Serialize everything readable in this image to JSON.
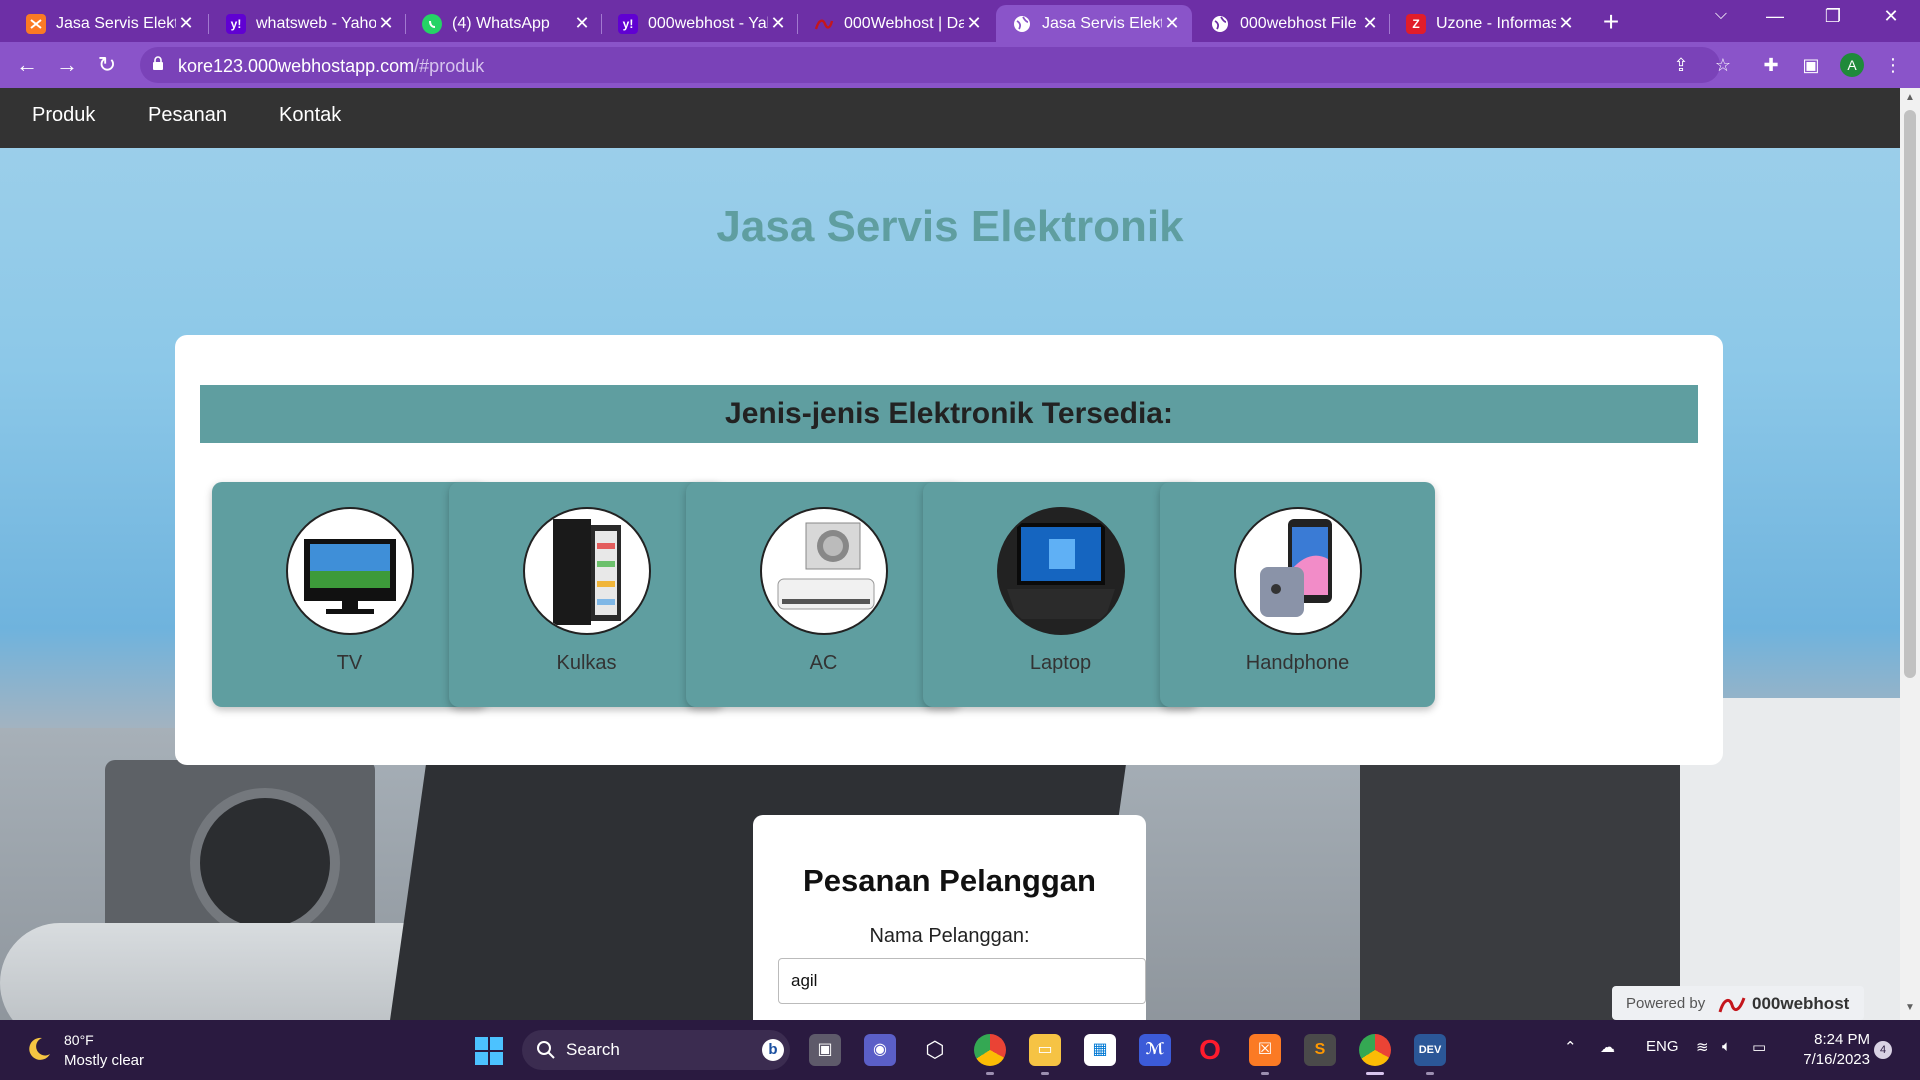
{
  "browser": {
    "tabs": [
      {
        "title": "Jasa Servis Elektronik",
        "favicon": "xampp-icon",
        "fav_color": "#fb7a24",
        "fav_text": "",
        "active": false
      },
      {
        "title": "whatsweb - Yahoo Search",
        "favicon": "yahoo-icon",
        "fav_color": "#6001d2",
        "fav_text": "y!",
        "active": false
      },
      {
        "title": "(4) WhatsApp",
        "favicon": "whatsapp-icon",
        "fav_color": "#25d366",
        "fav_text": "",
        "active": false
      },
      {
        "title": "000webhost - Yahoo Search",
        "favicon": "yahoo-icon",
        "fav_color": "#6001d2",
        "fav_text": "y!",
        "active": false
      },
      {
        "title": "000Webhost | Dashboard",
        "favicon": "000webhost-icon",
        "fav_color": "#c4161c",
        "fav_text": "",
        "active": false
      },
      {
        "title": "Jasa Servis Elektronik",
        "favicon": "globe-icon",
        "fav_color": "#ffffff",
        "fav_text": "",
        "active": true
      },
      {
        "title": "000webhost File Manager",
        "favicon": "globe-icon",
        "fav_color": "#ffffff",
        "fav_text": "",
        "active": false
      },
      {
        "title": "Uzone - Informasi",
        "favicon": "uzone-icon",
        "fav_color": "#e11d2a",
        "fav_text": "Z",
        "active": false
      }
    ],
    "url_host": "kore123.000webhostapp.com",
    "url_path": "/#produk",
    "profile_initial": "A"
  },
  "site": {
    "nav": [
      "Produk",
      "Pesanan",
      "Kontak"
    ],
    "hero_title": "Jasa Servis Elektronik",
    "products_heading": "Jenis-jenis Elektronik Tersedia:",
    "products": [
      {
        "label": "TV",
        "icon": "tv-icon"
      },
      {
        "label": "Kulkas",
        "icon": "fridge-icon"
      },
      {
        "label": "AC",
        "icon": "air-conditioner-icon"
      },
      {
        "label": "Laptop",
        "icon": "laptop-icon"
      },
      {
        "label": "Handphone",
        "icon": "smartphone-icon"
      }
    ],
    "order": {
      "title": "Pesanan Pelanggan",
      "name_label": "Nama Pelanggan:",
      "name_value": "agil"
    },
    "powered": {
      "prefix": "Powered by",
      "brand": "000webhost"
    }
  },
  "taskbar": {
    "weather_temp": "80°F",
    "weather_desc": "Mostly clear",
    "search_placeholder": "Search",
    "lang": "ENG",
    "time": "8:24 PM",
    "date": "7/16/2023",
    "notification_count": "4"
  },
  "colors": {
    "accent": "#5f9ea0",
    "site_nav_bg": "#333333",
    "browser_frame": "#6d2fa6"
  }
}
